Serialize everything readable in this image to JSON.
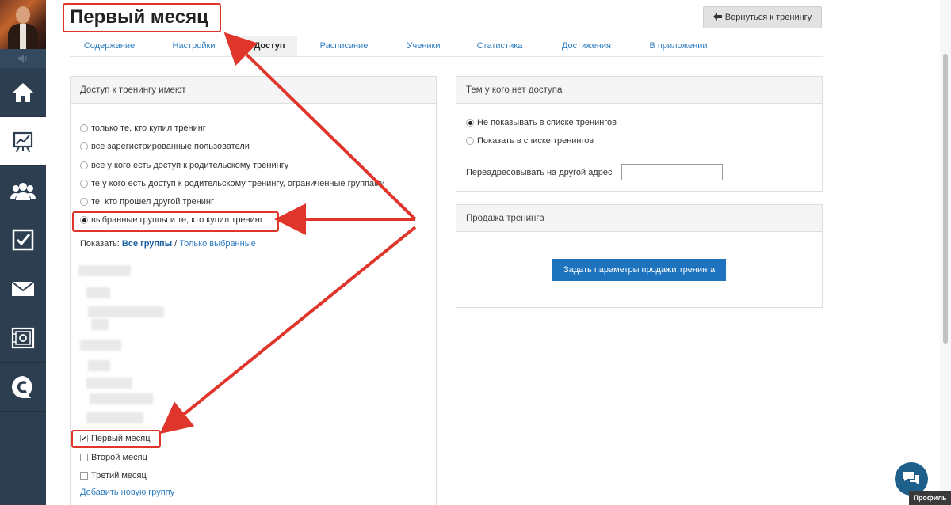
{
  "page": {
    "title": "Первый месяц",
    "back_button": "Вернуться к тренингу"
  },
  "tabs": [
    {
      "label": "Содержание",
      "active": false
    },
    {
      "label": "Настройки",
      "active": false
    },
    {
      "label": "Доступ",
      "active": true
    },
    {
      "label": "Расписание",
      "active": false
    },
    {
      "label": "Ученики",
      "active": false
    },
    {
      "label": "Статистика",
      "active": false
    },
    {
      "label": "Достижения",
      "active": false
    },
    {
      "label": "В приложении",
      "active": false
    }
  ],
  "sidebar": {
    "items": [
      {
        "icon": "home-icon",
        "active": false
      },
      {
        "icon": "training-chart-icon",
        "active": true
      },
      {
        "icon": "users-icon",
        "active": false
      },
      {
        "icon": "task-check-icon",
        "active": false
      },
      {
        "icon": "mail-icon",
        "active": false
      },
      {
        "icon": "safe-icon",
        "active": false
      },
      {
        "icon": "chat-logo-icon",
        "active": false
      }
    ]
  },
  "access": {
    "heading": "Доступ к тренингу имеют",
    "options": [
      {
        "label": "только те, кто купил тренинг",
        "selected": false
      },
      {
        "label": "все зарегистрированные пользователи",
        "selected": false
      },
      {
        "label": "все у кого есть доступ к родительскому тренингу",
        "selected": false
      },
      {
        "label": "те у кого есть доступ к родительскому тренингу, ограниченные группами",
        "selected": false
      },
      {
        "label": "те, кто прошел другой тренинг",
        "selected": false
      },
      {
        "label": "выбранные группы и те, кто купил тренинг",
        "selected": true
      }
    ],
    "show_label": "Показать:",
    "show_all": "Все группы",
    "show_separator": "/",
    "show_selected": "Только выбранные",
    "groups": [
      {
        "label": "Первый месяц",
        "checked": true
      },
      {
        "label": "Второй месяц",
        "checked": false
      },
      {
        "label": "Третий месяц",
        "checked": false
      }
    ],
    "add_group": "Добавить новую группу"
  },
  "no_access": {
    "heading": "Тем у кого нет доступа",
    "options": [
      {
        "label": "Не показывать в списке тренингов",
        "selected": true
      },
      {
        "label": "Показать в списке тренингов",
        "selected": false
      }
    ],
    "redirect_label": "Переадресовывать на другой адрес",
    "redirect_value": ""
  },
  "sale": {
    "heading": "Продажа тренинга",
    "button": "Задать параметры продажи тренинга"
  },
  "footer": {
    "profile": "Профиль"
  },
  "colors": {
    "sidebar": "#2c3e50",
    "link": "#2c7bbf",
    "primary_button": "#1e73be",
    "annotation_red": "#e0352b"
  }
}
